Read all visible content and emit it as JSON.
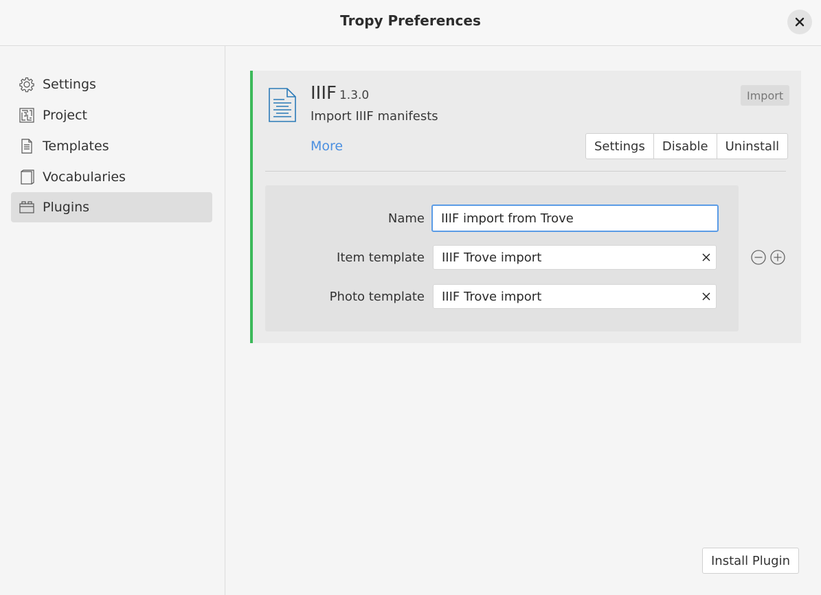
{
  "window": {
    "title": "Tropy Preferences"
  },
  "sidebar": {
    "items": [
      {
        "label": "Settings",
        "icon": "gear-icon"
      },
      {
        "label": "Project",
        "icon": "maze-icon"
      },
      {
        "label": "Templates",
        "icon": "document-icon"
      },
      {
        "label": "Vocabularies",
        "icon": "book-icon"
      },
      {
        "label": "Plugins",
        "icon": "plugin-icon",
        "active": true
      }
    ]
  },
  "plugin": {
    "name": "IIIF",
    "version": "1.3.0",
    "description": "Import IIIF manifests",
    "more_label": "More",
    "tag": "Import",
    "status_color": "#3cb95a",
    "buttons": {
      "settings": "Settings",
      "disable": "Disable",
      "uninstall": "Uninstall"
    },
    "config": {
      "name_label": "Name",
      "name_value": "IIIF import from Trove",
      "item_template_label": "Item template",
      "item_template_value": "IIIF Trove import",
      "photo_template_label": "Photo template",
      "photo_template_value": "IIIF Trove import"
    }
  },
  "footer": {
    "install_label": "Install Plugin"
  }
}
